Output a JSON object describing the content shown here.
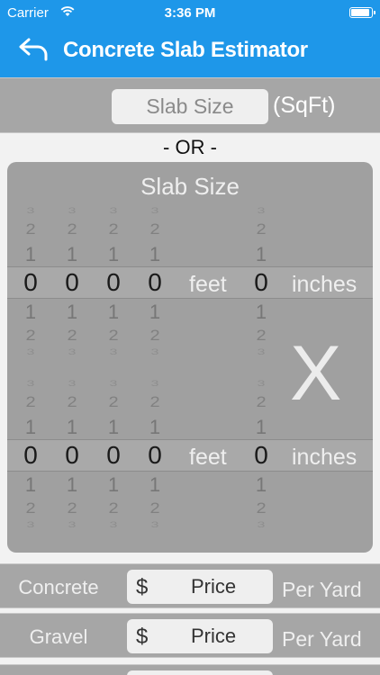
{
  "status_bar": {
    "carrier": "Carrier",
    "time": "3:36 PM"
  },
  "nav": {
    "title": "Concrete Slab Estimator",
    "back_icon": "back-arrow-icon"
  },
  "sqft": {
    "placeholder": "Slab Size",
    "unit": "(SqFt)"
  },
  "or_label": "- OR -",
  "picker_panel": {
    "title": "Slab Size",
    "times_sign": "X",
    "length": {
      "feet_digits": [
        "0",
        "0",
        "0",
        "0"
      ],
      "inch_digit": "0",
      "feet_label": "feet",
      "inches_label": "inches"
    },
    "width": {
      "feet_digits": [
        "0",
        "0",
        "0",
        "0"
      ],
      "inch_digit": "0",
      "feet_label": "feet",
      "inches_label": "inches"
    },
    "wheel_neighbors": {
      "top3": "3",
      "top2": "2",
      "top1": "1",
      "bottom1": "1",
      "bottom2": "2",
      "bottom3": "3"
    }
  },
  "price_rows": [
    {
      "label": "Concrete",
      "currency": "$",
      "placeholder": "Price",
      "unit": "Per Yard"
    },
    {
      "label": "Gravel",
      "currency": "$",
      "placeholder": "Price",
      "unit": "Per Yard"
    }
  ],
  "colors": {
    "accent": "#1e97e9",
    "panel": "#a0a0a0",
    "row": "#a6a6a6",
    "background": "#f2f2f2"
  }
}
